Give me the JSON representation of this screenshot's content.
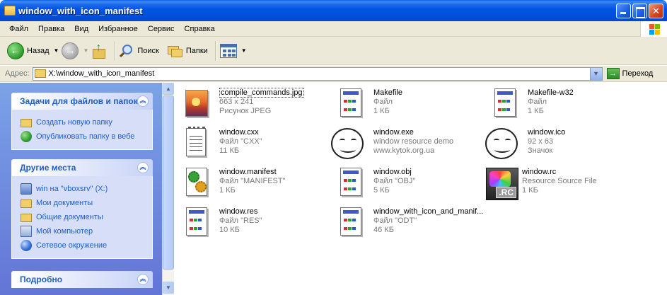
{
  "window": {
    "title": "window_with_icon_manifest"
  },
  "menu": [
    {
      "label": "Файл"
    },
    {
      "label": "Правка"
    },
    {
      "label": "Вид"
    },
    {
      "label": "Избранное"
    },
    {
      "label": "Сервис"
    },
    {
      "label": "Справка"
    }
  ],
  "toolbar": {
    "back_label": "Назад",
    "search_label": "Поиск",
    "folders_label": "Папки"
  },
  "address": {
    "label": "Адрес:",
    "value": "X:\\window_with_icon_manifest",
    "go_label": "Переход"
  },
  "tasks": {
    "title": "Задачи для файлов и папок",
    "items": [
      {
        "label": "Создать новую папку",
        "icon": "new-folder-icon"
      },
      {
        "label": "Опубликовать папку в вебе",
        "icon": "publish-web-icon"
      }
    ]
  },
  "places": {
    "title": "Другие места",
    "items": [
      {
        "label": "win на \"vboxsrv\" (X:)",
        "icon": "network-drive-icon"
      },
      {
        "label": "Мои документы",
        "icon": "my-documents-icon"
      },
      {
        "label": "Общие документы",
        "icon": "shared-documents-icon"
      },
      {
        "label": "Мой компьютер",
        "icon": "my-computer-icon"
      },
      {
        "label": "Сетевое окружение",
        "icon": "network-places-icon"
      }
    ]
  },
  "details": {
    "title": "Подробно"
  },
  "files": [
    {
      "name": "compile_commands.jpg",
      "line2": "663 x 241",
      "line3": "Рисунок JPEG",
      "icon": "jpeg-image-icon"
    },
    {
      "name": "Makefile",
      "line2": "Файл",
      "line3": "1 КБ",
      "icon": "generic-file-icon"
    },
    {
      "name": "Makefile-w32",
      "line2": "Файл",
      "line3": "1 КБ",
      "icon": "generic-file-icon"
    },
    {
      "name": "window.cxx",
      "line2": "Файл \"CXX\"",
      "line3": "11 КБ",
      "icon": "notepad-file-icon"
    },
    {
      "name": "window.exe",
      "line2": "window resource demo",
      "line3": "www.kytok.org.ua",
      "icon": "smiley-face-icon"
    },
    {
      "name": "window.ico",
      "line2": "92 x 63",
      "line3": "Значок",
      "icon": "smiley-face-icon"
    },
    {
      "name": "window.manifest",
      "line2": "Файл \"MANIFEST\"",
      "line3": "1 КБ",
      "icon": "manifest-file-icon"
    },
    {
      "name": "window.obj",
      "line2": "Файл \"OBJ\"",
      "line3": "5 КБ",
      "icon": "generic-file-icon"
    },
    {
      "name": "window.rc",
      "line2": "Resource Source File",
      "line3": "1 КБ",
      "icon": "rc-file-icon"
    },
    {
      "name": "window.res",
      "line2": "Файл \"RES\"",
      "line3": "10 КБ",
      "icon": "generic-file-icon"
    },
    {
      "name": "window_with_icon_and_manif...",
      "line2": "Файл \"ODT\"",
      "line3": "46 КБ",
      "icon": "generic-file-icon"
    }
  ],
  "colors": {
    "title_blue": "#0054e3",
    "taskpane_link": "#215dc6",
    "taskpane_bg": "#d6dff7"
  }
}
